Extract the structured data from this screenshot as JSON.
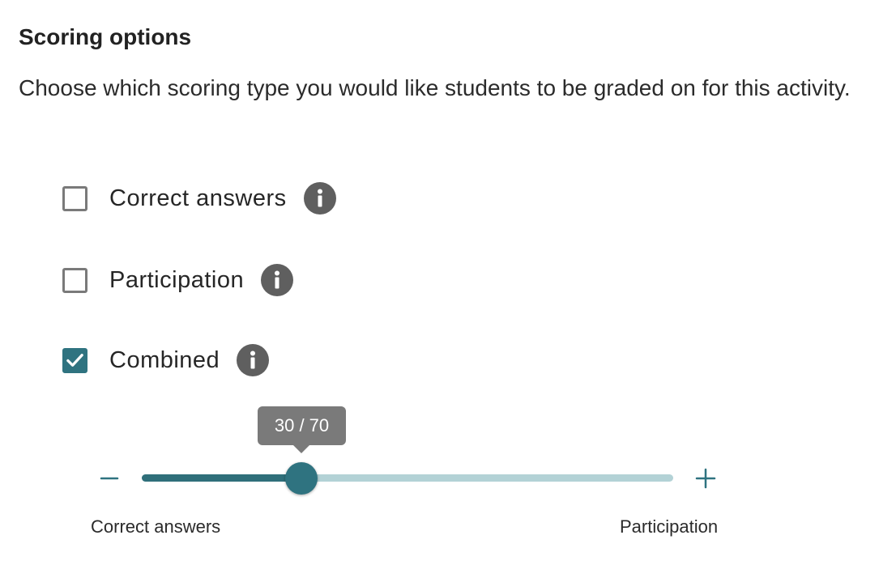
{
  "section": {
    "title": "Scoring options",
    "description": "Choose which scoring type you would like students to be graded on for this activity."
  },
  "options": [
    {
      "label": "Correct answers",
      "checked": false
    },
    {
      "label": "Participation",
      "checked": false
    },
    {
      "label": "Combined",
      "checked": true
    }
  ],
  "slider": {
    "value_text": "30 / 70",
    "correct_answers_weight": 30,
    "participation_weight": 70,
    "fraction": 0.3,
    "min_label": "Correct answers",
    "max_label": "Participation",
    "decrement_icon": "minus-icon",
    "increment_icon": "plus-icon"
  },
  "colors": {
    "accent": "#2f7380",
    "track_fill": "#2f6f7a",
    "track_rest": "#b3d2d6",
    "info_icon_bg": "#5f5f5f",
    "tooltip_bg": "#7a7a7a"
  }
}
